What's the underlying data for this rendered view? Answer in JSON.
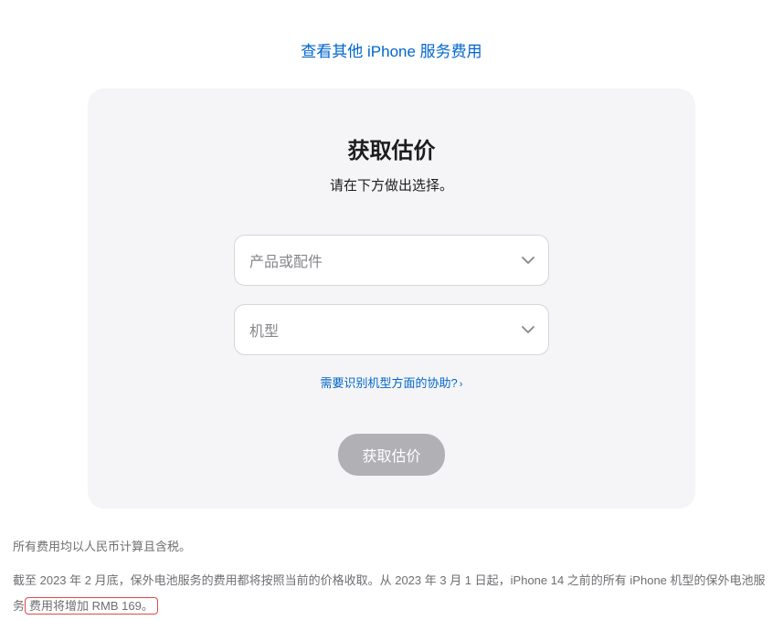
{
  "topLink": {
    "label": "查看其他 iPhone 服务费用"
  },
  "card": {
    "title": "获取估价",
    "subtitle": "请在下方做出选择。",
    "selectProduct": {
      "placeholder": "产品或配件"
    },
    "selectModel": {
      "placeholder": "机型"
    },
    "helpLink": {
      "label": "需要识别机型方面的协助?"
    },
    "submitButton": {
      "label": "获取估价"
    }
  },
  "footer": {
    "line1": "所有费用均以人民币计算且含税。",
    "line2_part1": "截至 2023 年 2 月底，保外电池服务的费用都将按照当前的价格收取。从 2023 年 3 月 1 日起，iPhone 14 之前的所有 iPhone 机型的保外电池服务",
    "line2_highlight": "费用将增加 RMB 169。"
  }
}
